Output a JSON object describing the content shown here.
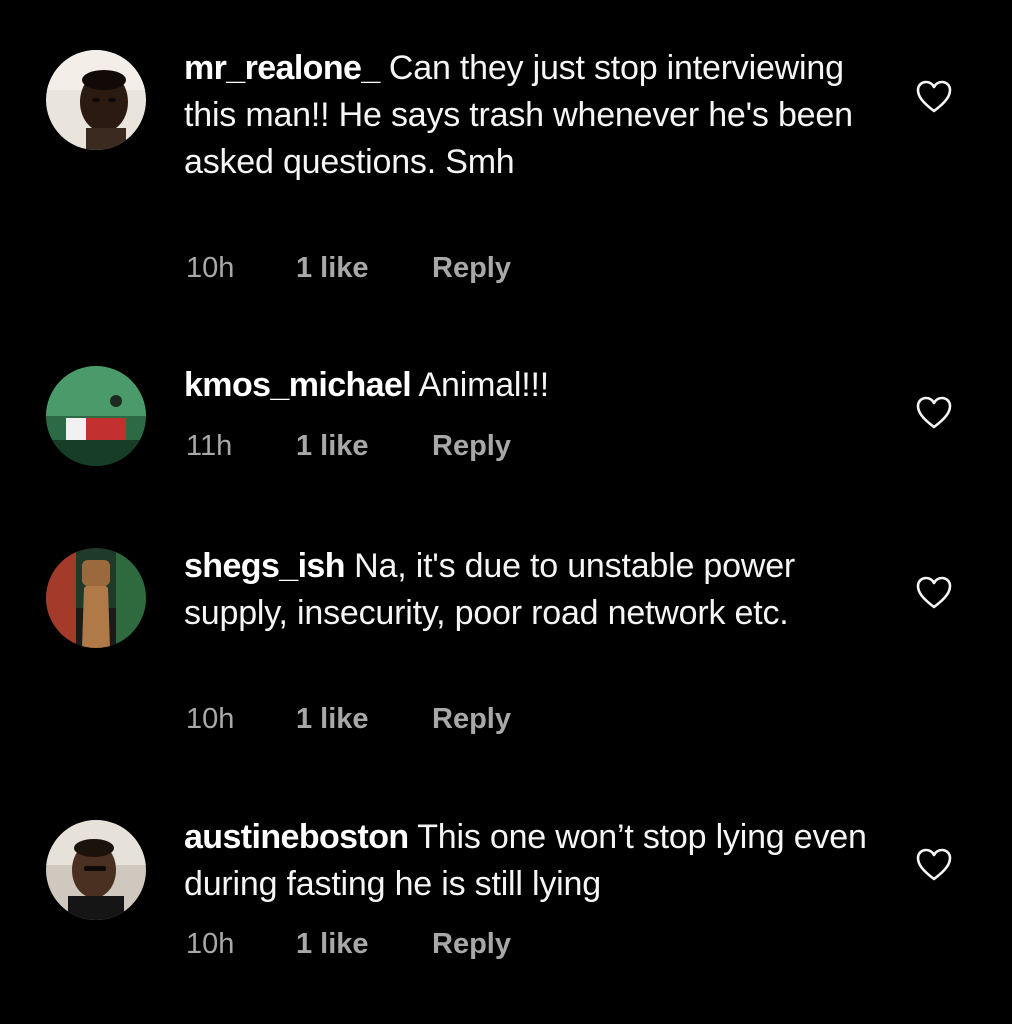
{
  "comments": [
    {
      "username": "mr_realone_",
      "text": "Can they just stop interviewing this man!! He says trash whenever he's been asked questions. Smh",
      "time": "10h",
      "likes": "1 like",
      "reply_label": "Reply",
      "avatar_icon": "avatar-photo"
    },
    {
      "username": "kmos_michael",
      "text": "Animal!!!",
      "time": "11h",
      "likes": "1 like",
      "reply_label": "Reply",
      "avatar_icon": "avatar-photo"
    },
    {
      "username": "shegs_ish",
      "text": "Na, it's due to unstable power supply, insecurity, poor road network etc.",
      "time": "10h",
      "likes": "1 like",
      "reply_label": "Reply",
      "avatar_icon": "avatar-photo"
    },
    {
      "username": "austineboston",
      "text": "This one won’t stop lying even during fasting he is still lying",
      "time": "10h",
      "likes": "1 like",
      "reply_label": "Reply",
      "avatar_icon": "avatar-photo"
    }
  ],
  "like_icon": "heart-outline-icon",
  "colors": {
    "background": "#000000",
    "username": "#ffffff",
    "text": "#f5f5f5",
    "meta": "#a8a8a8"
  }
}
